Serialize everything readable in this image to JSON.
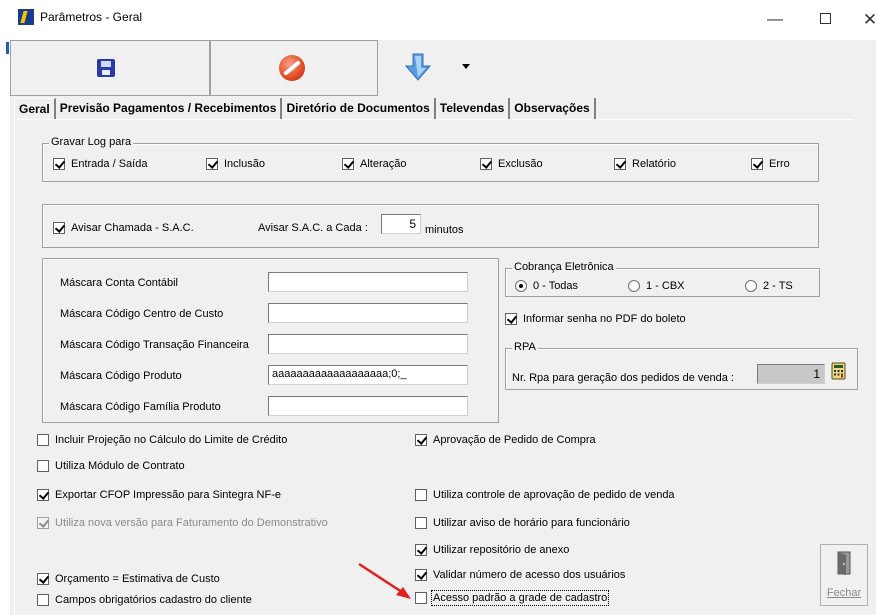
{
  "window": {
    "title": "Parâmetros - Geral"
  },
  "tabs": [
    {
      "label": "Geral",
      "active": true
    },
    {
      "label": "Previsão Pagamentos / Recebimentos"
    },
    {
      "label": "Diretório de Documentos"
    },
    {
      "label": "Televendas"
    },
    {
      "label": "Observações"
    }
  ],
  "log_group": {
    "title": "Gravar Log para",
    "items": [
      {
        "label": "Entrada / Saída",
        "checked": true
      },
      {
        "label": "Inclusão",
        "checked": true
      },
      {
        "label": "Alteração",
        "checked": true
      },
      {
        "label": "Exclusão",
        "checked": true
      },
      {
        "label": "Relatório",
        "checked": true
      },
      {
        "label": "Erro",
        "checked": true
      }
    ]
  },
  "sac": {
    "avisar_label": "Avisar Chamada - S.A.C.",
    "avisar_checked": true,
    "cada_label": "Avisar S.A.C. a Cada :",
    "cada_value": "5",
    "unit": "minutos"
  },
  "masks": [
    {
      "label": "Máscara Conta Contábil",
      "value": ""
    },
    {
      "label": "Máscara Código Centro de Custo",
      "value": ""
    },
    {
      "label": "Máscara Código Transação Financeira",
      "value": ""
    },
    {
      "label": "Máscara Código Produto",
      "value": "aaaaaaaaaaaaaaaaaaa;0;_"
    },
    {
      "label": "Máscara Código Família Produto",
      "value": ""
    }
  ],
  "cobranca": {
    "title": "Cobrança Eletrônica",
    "options": [
      {
        "label": "0 - Todas",
        "checked": true
      },
      {
        "label": "1 - CBX",
        "checked": false
      },
      {
        "label": "2 - TS",
        "checked": false
      }
    ],
    "informar_senha": "Informar senha no PDF do boleto"
  },
  "rpa": {
    "title": "RPA",
    "label": "Nr. Rpa para geração dos pedidos de venda :",
    "value": "1"
  },
  "options_left": {
    "incluir_projecao": "Incluir Projeção no Cálculo do Limite de Crédito",
    "utiliza_contrato": "Utiliza Módulo de Contrato",
    "exportar_cfop": "Exportar CFOP Impressão para Sintegra NF-e",
    "nova_versao": "Utiliza nova versão para Faturamento do Demonstrativo",
    "orcamento": "Orçamento = Estimativa de Custo",
    "campos_obrigatorios": "Campos obrigatórios cadastro do cliente"
  },
  "options_right": {
    "aprovacao_pedido": "Aprovação de Pedido de Compra",
    "controle_aprovacao": "Utiliza controle de aprovação de pedido de venda",
    "aviso_horario": "Utilizar aviso de horário para funcionário",
    "repositorio_anexo": "Utilizar repositório de anexo",
    "validar_acesso": "Validar número de acesso dos usuários",
    "acesso_padrao": "Acesso padrão a grade de cadastro"
  },
  "fechar": {
    "label": "Fechar"
  }
}
